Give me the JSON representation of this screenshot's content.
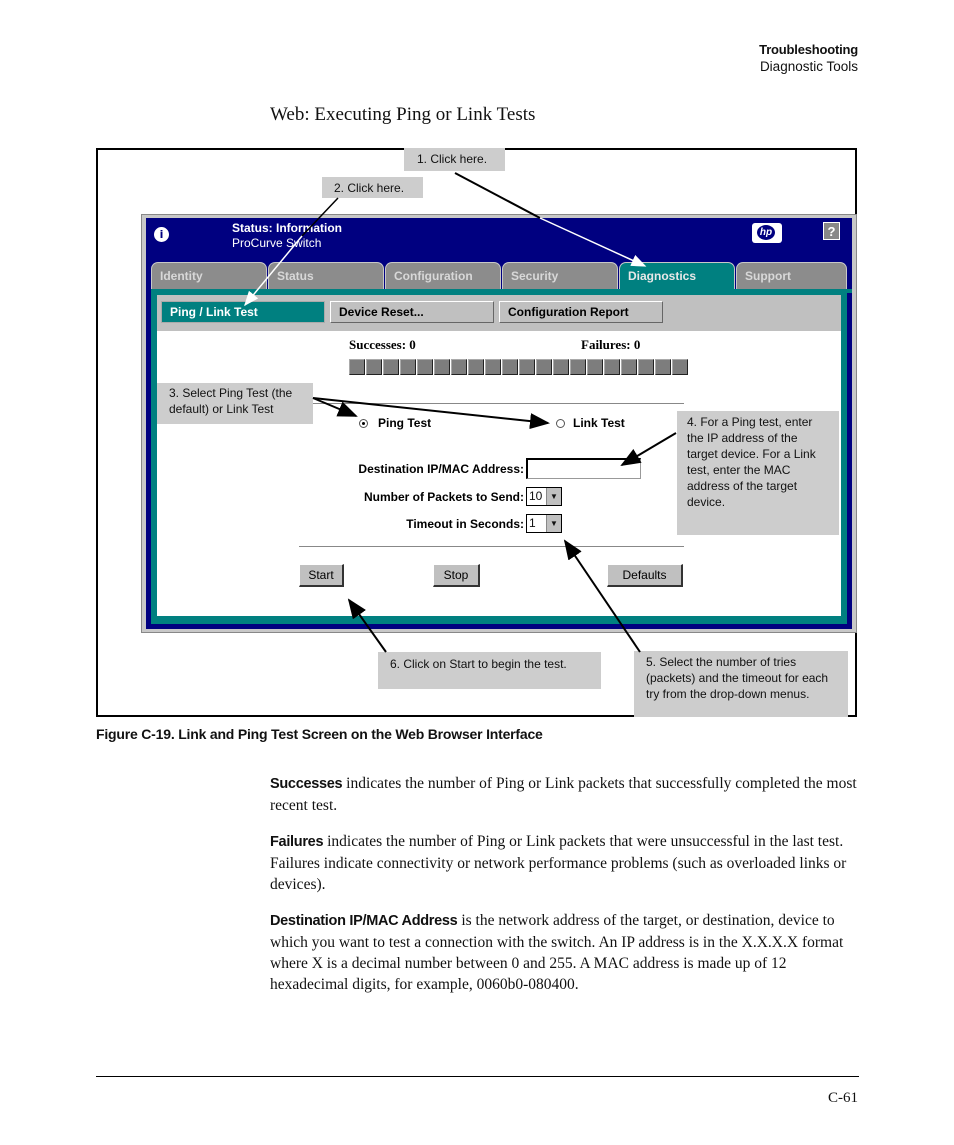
{
  "running_header": {
    "chapter": "Troubleshooting",
    "section": "Diagnostic Tools"
  },
  "section_title": "Web: Executing Ping or Link Tests",
  "app": {
    "status_title": "Status: Information",
    "product": "ProCurve Switch",
    "help_label": "?",
    "logo_label": "hp",
    "tabs": [
      {
        "label": "Identity",
        "active": false
      },
      {
        "label": "Status",
        "active": false
      },
      {
        "label": "Configuration",
        "active": false
      },
      {
        "label": "Security",
        "active": false
      },
      {
        "label": "Diagnostics",
        "active": true
      },
      {
        "label": "Support",
        "active": false
      }
    ],
    "subnav": [
      {
        "label": "Ping / Link Test",
        "active": true
      },
      {
        "label": "Device Reset...",
        "active": false
      },
      {
        "label": "Configuration Report",
        "active": false
      }
    ],
    "successes_label": "Successes: 0",
    "failures_label": "Failures: 0",
    "progress_segments": 20,
    "progress_filled": 0,
    "radio_ping": {
      "label": "Ping Test",
      "selected": true
    },
    "radio_link": {
      "label": "Link Test",
      "selected": false
    },
    "dest_label": "Destination IP/MAC Address:",
    "dest_value": "",
    "packets_label": "Number of Packets to Send:",
    "packets_value": "10",
    "timeout_label": "Timeout in Seconds:",
    "timeout_value": "1",
    "buttons": {
      "start": "Start",
      "stop": "Stop",
      "defaults": "Defaults"
    }
  },
  "callouts": {
    "c1": "1. Click here.",
    "c2": "2. Click here.",
    "c3": "3. Select Ping Test (the default) or Link Test",
    "c4": "4. For a Ping test, enter the IP address of the target device. For a Link test, enter the MAC address of the target    device.",
    "c5": "5. Select the number of tries (packets) and the timeout for each try from the drop-down menus.",
    "c6": "6. Click on Start to begin the test."
  },
  "figure_caption": "Figure C-19. Link and Ping Test Screen on the Web Browser Interface",
  "paragraphs": [
    {
      "term": "Successes",
      "text": " indicates the number of Ping or Link packets that successfully completed the most recent test."
    },
    {
      "term": "Failures",
      "text": " indicates the number of Ping or Link packets that were unsuccessful in the last test. Failures indicate connectivity or network performance problems (such as overloaded links or devices)."
    },
    {
      "term": "Destination IP/MAC Address",
      "text": " is the network address of the target, or destination, device to which you want to test a connection with the switch. An IP address is in the X.X.X.X format where X is a decimal number between 0 and 255. A MAC address is made up of 12 hexadecimal digits, for example, 0060b0-080400."
    }
  ],
  "page_number": "C-61"
}
